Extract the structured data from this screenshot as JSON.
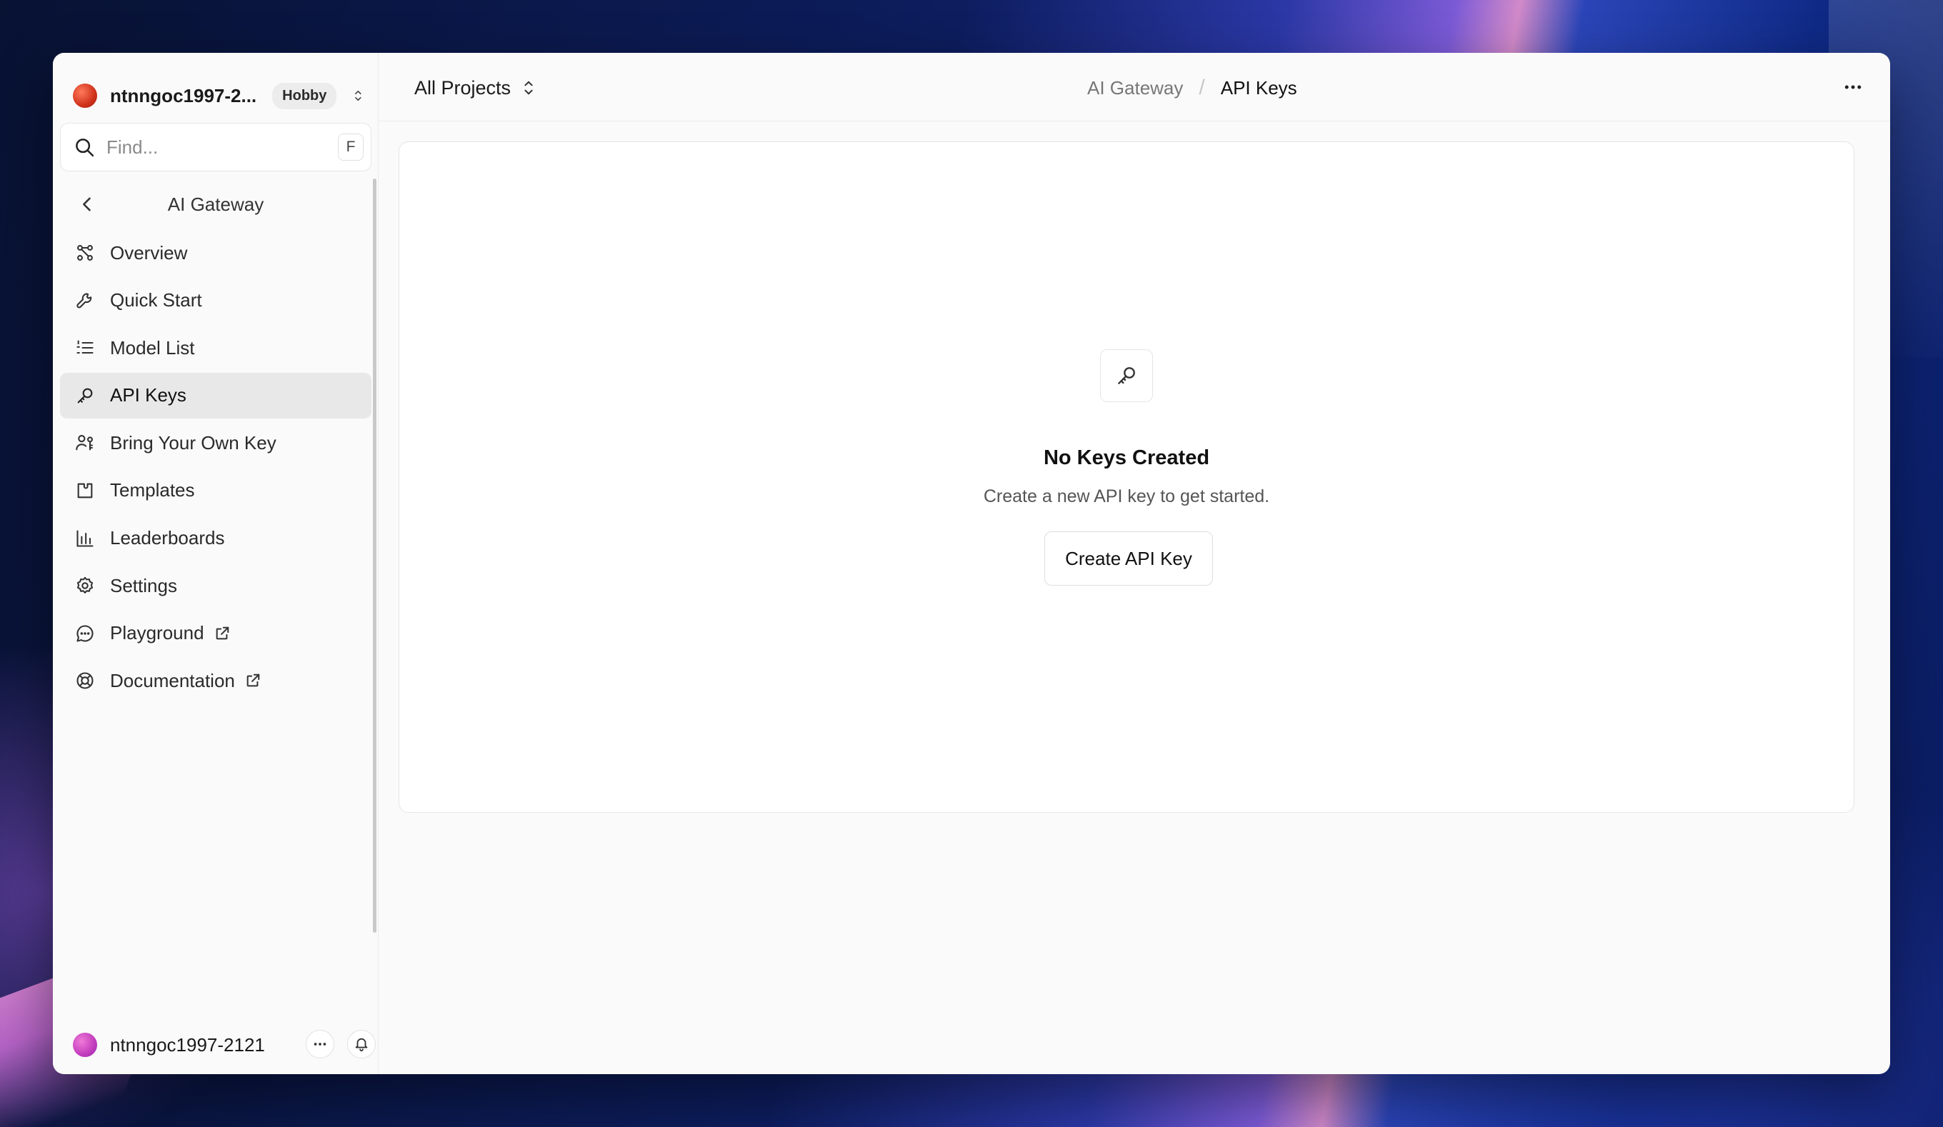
{
  "team": {
    "name": "ntnngoc1997-2...",
    "plan": "Hobby"
  },
  "search": {
    "placeholder": "Find...",
    "shortcut": "F"
  },
  "sidebar": {
    "section_title": "AI Gateway",
    "items": [
      {
        "label": "Overview",
        "icon": "overview-icon"
      },
      {
        "label": "Quick Start",
        "icon": "wrench-icon"
      },
      {
        "label": "Model List",
        "icon": "list-icon"
      },
      {
        "label": "API Keys",
        "icon": "key-icon",
        "active": true
      },
      {
        "label": "Bring Your Own Key",
        "icon": "user-key-icon"
      },
      {
        "label": "Templates",
        "icon": "templates-icon"
      },
      {
        "label": "Leaderboards",
        "icon": "bar-chart-icon"
      },
      {
        "label": "Settings",
        "icon": "gear-icon"
      },
      {
        "label": "Playground",
        "icon": "chat-icon",
        "external": true
      },
      {
        "label": "Documentation",
        "icon": "lifebuoy-icon",
        "external": true
      }
    ]
  },
  "user": {
    "name": "ntnngoc1997-2121"
  },
  "header": {
    "project": "All Projects",
    "breadcrumb": {
      "parent": "AI Gateway",
      "current": "API Keys"
    }
  },
  "empty_state": {
    "icon": "key-icon",
    "title": "No Keys Created",
    "description": "Create a new API key to get started.",
    "button": "Create API Key"
  }
}
